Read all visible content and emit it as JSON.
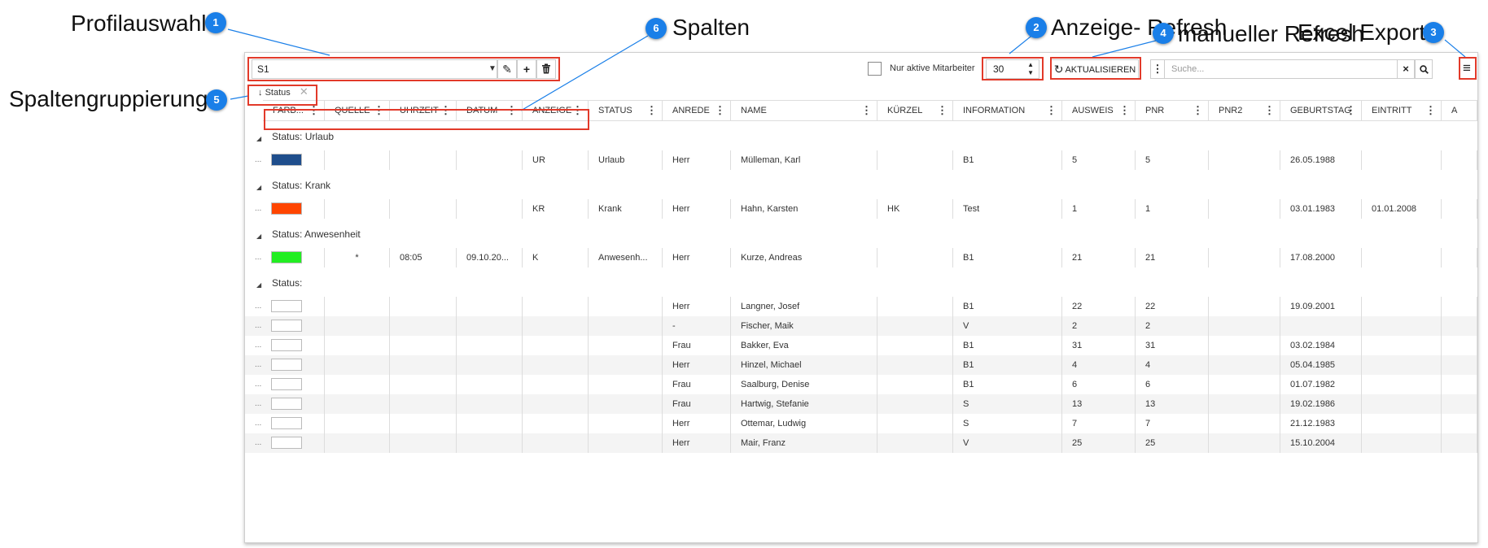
{
  "callouts": [
    {
      "num": "1",
      "text": "Profilauswahl"
    },
    {
      "num": "2",
      "text": "Anzeige- Refresh"
    },
    {
      "num": "3",
      "text": "Excel Export"
    },
    {
      "num": "4",
      "text": "manueller Refresh"
    },
    {
      "num": "5",
      "text": "Spaltengruppierung"
    },
    {
      "num": "6",
      "text": "Spalten"
    }
  ],
  "toolbar": {
    "profile_value": "S1",
    "only_active_label": "Nur aktive Mitarbeiter",
    "refresh_interval": "30",
    "refresh_label": "AKTUALISIEREN",
    "search_placeholder": "Suche..."
  },
  "grouping": {
    "chip_label": "Status"
  },
  "columns": [
    "FARB...",
    "QUELLE",
    "UHRZEIT",
    "DATUM",
    "ANZEIGE",
    "STATUS",
    "ANREDE",
    "NAME",
    "KÜRZEL",
    "INFORMATION",
    "AUSWEIS",
    "PNR",
    "PNR2",
    "GEBURTSTAG",
    "EINTRITT",
    "A"
  ],
  "groups": [
    {
      "title": "Status: Urlaub",
      "rows": [
        {
          "color": "#1f4e8c",
          "quelle": "",
          "uhrzeit": "",
          "datum": "",
          "anzeige": "UR",
          "status": "Urlaub",
          "anrede": "Herr",
          "name": "Mülleman, Karl",
          "kuerzel": "",
          "information": "B1",
          "ausweis": "5",
          "pnr": "5",
          "pnr2": "",
          "geburtstag": "26.05.1988",
          "eintritt": ""
        }
      ]
    },
    {
      "title": "Status: Krank",
      "rows": [
        {
          "color": "#ff4500",
          "quelle": "",
          "uhrzeit": "",
          "datum": "",
          "anzeige": "KR",
          "status": "Krank",
          "anrede": "Herr",
          "name": "Hahn, Karsten",
          "kuerzel": "HK",
          "information": "Test",
          "ausweis": "1",
          "pnr": "1",
          "pnr2": "",
          "geburtstag": "03.01.1983",
          "eintritt": "01.01.2008"
        }
      ]
    },
    {
      "title": "Status: Anwesenheit",
      "rows": [
        {
          "color": "#22ee22",
          "quelle": "*",
          "uhrzeit": "08:05",
          "datum": "09.10.20...",
          "anzeige": "K",
          "status": "Anwesenh...",
          "anrede": "Herr",
          "name": "Kurze, Andreas",
          "kuerzel": "",
          "information": "B1",
          "ausweis": "21",
          "pnr": "21",
          "pnr2": "",
          "geburtstag": "17.08.2000",
          "eintritt": ""
        }
      ]
    },
    {
      "title": "Status:",
      "rows": [
        {
          "color": "#ffffff",
          "quelle": "",
          "uhrzeit": "",
          "datum": "",
          "anzeige": "",
          "status": "",
          "anrede": "Herr",
          "name": "Langner, Josef",
          "kuerzel": "",
          "information": "B1",
          "ausweis": "22",
          "pnr": "22",
          "pnr2": "",
          "geburtstag": "19.09.2001",
          "eintritt": ""
        },
        {
          "color": "#ffffff",
          "quelle": "",
          "uhrzeit": "",
          "datum": "",
          "anzeige": "",
          "status": "",
          "anrede": "-",
          "name": "Fischer, Maik",
          "kuerzel": "",
          "information": "V",
          "ausweis": "2",
          "pnr": "2",
          "pnr2": "",
          "geburtstag": "",
          "eintritt": ""
        },
        {
          "color": "#ffffff",
          "quelle": "",
          "uhrzeit": "",
          "datum": "",
          "anzeige": "",
          "status": "",
          "anrede": "Frau",
          "name": "Bakker, Eva",
          "kuerzel": "",
          "information": "B1",
          "ausweis": "31",
          "pnr": "31",
          "pnr2": "",
          "geburtstag": "03.02.1984",
          "eintritt": ""
        },
        {
          "color": "#ffffff",
          "quelle": "",
          "uhrzeit": "",
          "datum": "",
          "anzeige": "",
          "status": "",
          "anrede": "Herr",
          "name": "Hinzel, Michael",
          "kuerzel": "",
          "information": "B1",
          "ausweis": "4",
          "pnr": "4",
          "pnr2": "",
          "geburtstag": "05.04.1985",
          "eintritt": ""
        },
        {
          "color": "#ffffff",
          "quelle": "",
          "uhrzeit": "",
          "datum": "",
          "anzeige": "",
          "status": "",
          "anrede": "Frau",
          "name": "Saalburg, Denise",
          "kuerzel": "",
          "information": "B1",
          "ausweis": "6",
          "pnr": "6",
          "pnr2": "",
          "geburtstag": "01.07.1982",
          "eintritt": ""
        },
        {
          "color": "#ffffff",
          "quelle": "",
          "uhrzeit": "",
          "datum": "",
          "anzeige": "",
          "status": "",
          "anrede": "Frau",
          "name": "Hartwig, Stefanie",
          "kuerzel": "",
          "information": "S",
          "ausweis": "13",
          "pnr": "13",
          "pnr2": "",
          "geburtstag": "19.02.1986",
          "eintritt": ""
        },
        {
          "color": "#ffffff",
          "quelle": "",
          "uhrzeit": "",
          "datum": "",
          "anzeige": "",
          "status": "",
          "anrede": "Herr",
          "name": "Ottemar, Ludwig",
          "kuerzel": "",
          "information": "S",
          "ausweis": "7",
          "pnr": "7",
          "pnr2": "",
          "geburtstag": "21.12.1983",
          "eintritt": ""
        },
        {
          "color": "#ffffff",
          "quelle": "",
          "uhrzeit": "",
          "datum": "",
          "anzeige": "",
          "status": "",
          "anrede": "Herr",
          "name": "Mair, Franz",
          "kuerzel": "",
          "information": "V",
          "ausweis": "25",
          "pnr": "25",
          "pnr2": "",
          "geburtstag": "15.10.2004",
          "eintritt": ""
        }
      ]
    }
  ]
}
